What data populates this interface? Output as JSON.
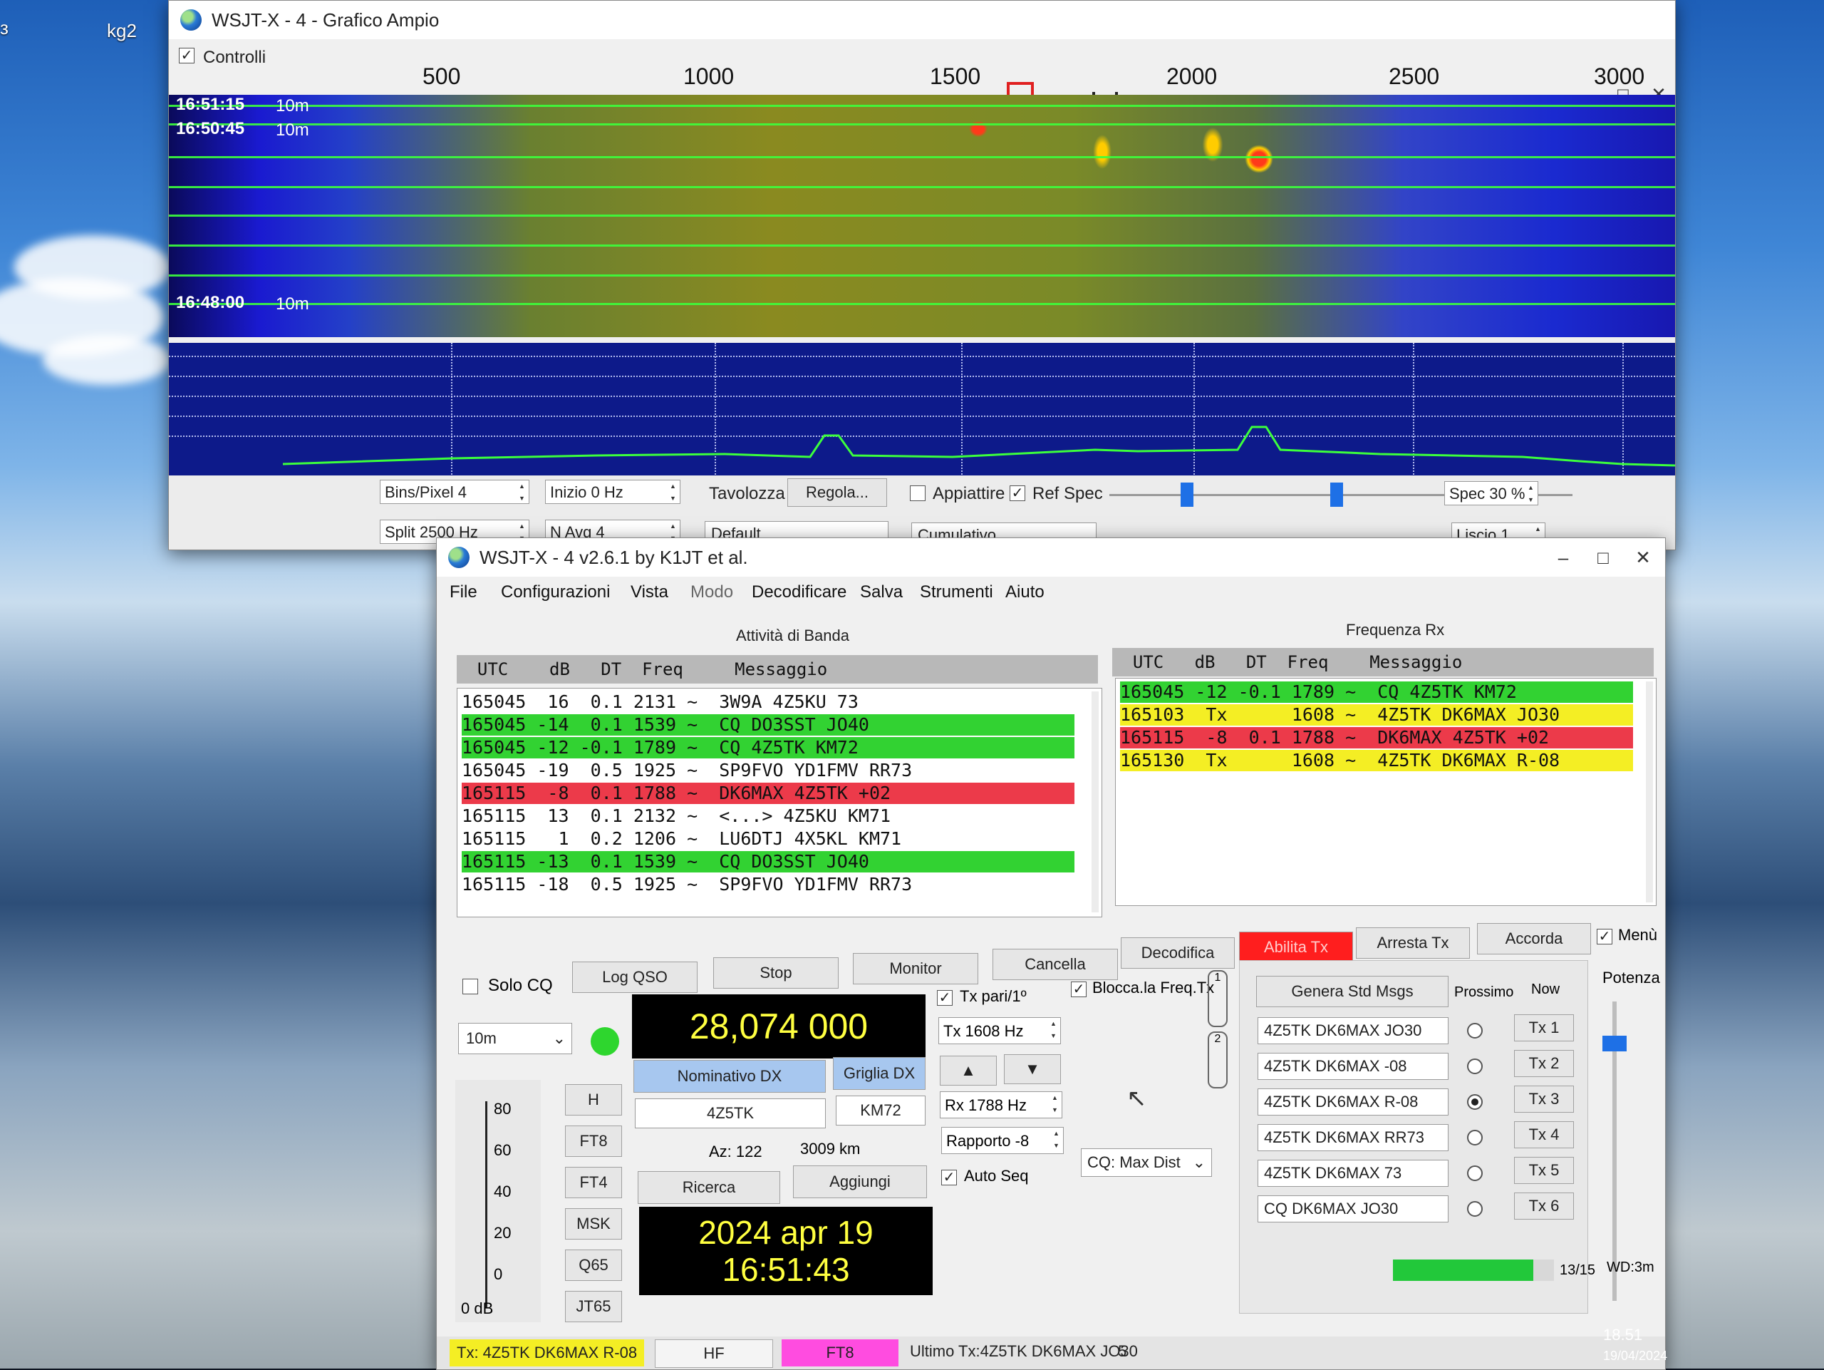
{
  "desktop": {
    "icon_label_1": "з",
    "icon_label_2": "kg2"
  },
  "wide_graph": {
    "title": "WSJT-X - 4 - Grafico Ampio",
    "controls_label": "Controlli",
    "freq_labels": [
      "500",
      "1000",
      "1500",
      "2000",
      "2500",
      "3000"
    ],
    "timestamps": [
      {
        "time": "16:51:15",
        "band": "10m"
      },
      {
        "time": "16:50:45",
        "band": "10m"
      },
      {
        "time": "16:48:00",
        "band": "10m"
      }
    ],
    "bins_pixel": "Bins/Pixel  4",
    "start": "Inizio 0 Hz",
    "split": "Split  2500  Hz",
    "n_avg": "N Avg 4",
    "palette_label": "Tavolozza",
    "adjust_button": "Regola...",
    "palette_value": "Default",
    "flatten_label": "Appiattire",
    "ref_spec_label": "Ref Spec",
    "cumulative_value": "Cumulativo",
    "spec_value": "Spec 30 %",
    "smooth_value": "Liscio  1"
  },
  "main": {
    "title": "WSJT-X - 4   v2.6.1   by K1JT et al.",
    "menu": [
      "File",
      "Configurazioni",
      "Vista",
      "Modo",
      "Decodificare",
      "Salva",
      "Strumenti",
      "Aiuto"
    ],
    "band_activity": {
      "title": "Attività di Banda",
      "header": "  UTC    dB   DT  Freq     Messaggio",
      "rows": [
        {
          "text": "165045  16  0.1 2131 ~  3W9A 4Z5KU 73",
          "hl": ""
        },
        {
          "text": "165045 -14  0.1 1539 ~  CQ DO3SST JO40",
          "hl": "green"
        },
        {
          "text": "165045 -12 -0.1 1789 ~  CQ 4Z5TK KM72",
          "hl": "green"
        },
        {
          "text": "165045 -19  0.5 1925 ~  SP9FVO YD1FMV RR73",
          "hl": ""
        },
        {
          "text": "165115  -8  0.1 1788 ~  DK6MAX 4Z5TK +02",
          "hl": "red"
        },
        {
          "text": "165115  13  0.1 2132 ~  <...> 4Z5KU KM71",
          "hl": ""
        },
        {
          "text": "165115   1  0.2 1206 ~  LU6DTJ 4X5KL KM71",
          "hl": ""
        },
        {
          "text": "165115 -13  0.1 1539 ~  CQ DO3SST JO40",
          "hl": "green"
        },
        {
          "text": "165115 -18  0.5 1925 ~  SP9FVO YD1FMV RR73",
          "hl": ""
        }
      ]
    },
    "rx_frequency": {
      "title": "Frequenza Rx",
      "header": "  UTC   dB   DT  Freq    Messaggio",
      "rows": [
        {
          "text": "165045 -12 -0.1 1789 ~  CQ 4Z5TK KM72",
          "hl": "green"
        },
        {
          "text": "165103  Tx      1608 ~  4Z5TK DK6MAX JO30",
          "hl": "yellow"
        },
        {
          "text": "165115  -8  0.1 1788 ~  DK6MAX 4Z5TK +02",
          "hl": "red"
        },
        {
          "text": "165130  Tx      1608 ~  4Z5TK DK6MAX R-08",
          "hl": "yellow"
        }
      ]
    },
    "buttons": {
      "solo_cq": "Solo CQ",
      "log_qso": "Log QSO",
      "stop": "Stop",
      "monitor": "Monitor",
      "erase": "Cancella",
      "decode": "Decodifica",
      "enable_tx": "Abilita Tx",
      "halt_tx": "Arresta Tx",
      "tune": "Accorda",
      "menus": "Menù"
    },
    "band": "10m",
    "dial_freq": "28,074 000",
    "tx_even": "Tx pari/1º",
    "hold_tx": "Blocca.la Freq.Tx",
    "tx_freq": "Tx  1608  Hz",
    "rx_freq": "Rx  1788  Hz",
    "report": "Rapporto -8",
    "auto_seq": "Auto Seq",
    "cq_mode": "CQ: Max Dist",
    "dx_call_label": "Nominativo DX",
    "dx_grid_label": "Griglia DX",
    "dx_call": "4Z5TK",
    "dx_grid": "KM72",
    "azimuth": "Az: 122",
    "distance": "3009 km",
    "lookup": "Ricerca",
    "add": "Aggiungi",
    "date": "2024 apr 19",
    "time": "16:51:43",
    "modes": [
      "H",
      "FT8",
      "FT4",
      "MSK",
      "Q65",
      "JT65"
    ],
    "meter_ticks": [
      "80",
      "60",
      "40",
      "20",
      "0"
    ],
    "meter_unit": "0 dB",
    "tab_labels": [
      "1",
      "2"
    ],
    "gen_std_msgs": "Genera Std Msgs",
    "next_label": "Prossimo",
    "now_label": "Now",
    "tx_messages": [
      "4Z5TK DK6MAX JO30",
      "4Z5TK DK6MAX -08",
      "4Z5TK DK6MAX R-08",
      "4Z5TK DK6MAX RR73",
      "4Z5TK DK6MAX 73",
      "CQ DK6MAX JO30"
    ],
    "tx_buttons": [
      "Tx 1",
      "Tx 2",
      "Tx 3",
      "Tx 4",
      "Tx 5",
      "Tx 6"
    ],
    "selected_tx_index": 2,
    "power_label": "Potenza",
    "status": {
      "tx_msg": "Tx: 4Z5TK DK6MAX R-08",
      "band_type": "HF",
      "mode": "FT8",
      "last_tx": "Ultimo Tx:4Z5TK DK6MAX JO30",
      "count": "5",
      "progress_fraction": 0.87,
      "period": "13/15",
      "wd": "WD:3m"
    }
  },
  "taskbar": {
    "time": "18.51",
    "date": "19/04/2024"
  },
  "colors": {
    "green": "#32d232",
    "red": "#ec3a4a",
    "yellow": "#f4ee24",
    "enable_tx": "#ff1e1e",
    "ft8": "#ff4ce0"
  }
}
